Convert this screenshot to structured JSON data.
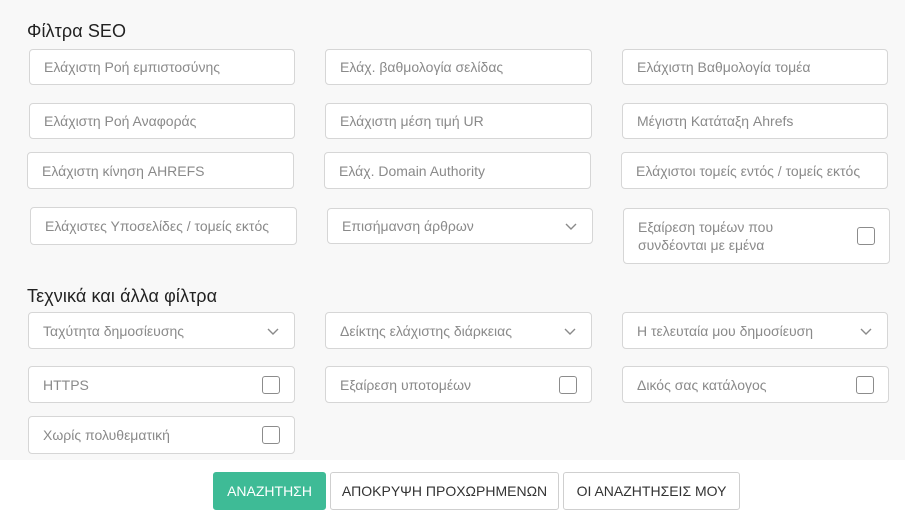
{
  "seo": {
    "heading": "Φίλτρα SEO",
    "fields": {
      "min_trust_flow": "Ελάχιστη Ροή εμπιστοσύνης",
      "min_page_rating": "Ελάχ. βαθμολογία σελίδας",
      "min_domain_rating": "Ελάχιστη Βαθμολογία τομέα",
      "min_citation_flow": "Ελάχιστη Ροή Αναφοράς",
      "min_avg_ur": "Ελάχιστη μέση τιμή UR",
      "max_ahrefs_rank": "Μέγιστη Κατάταξη Ahrefs",
      "min_ahrefs_traffic": "Ελάχιστη κίνηση AHREFS",
      "min_domain_authority": "Ελάχ. Domain Authority",
      "min_referring_domains": "Ελάχιστοι τομείς εντός / τομείς εκτός",
      "min_subpages": "Ελάχιστες Υποσελίδες / τομείς εκτός",
      "article_marking": "Επισήμανση άρθρων",
      "exclude_linked_domains": "Εξαίρεση τομέων που συνδέονται με εμένα"
    }
  },
  "technical": {
    "heading": "Τεχνικά και άλλα φίλτρα",
    "fields": {
      "publish_speed": "Ταχύτητα δημοσίευσης",
      "min_duration": "Δείκτης ελάχιστης διάρκειας",
      "my_last_publication": "Η τελευταία μου δημοσίευση",
      "https": "HTTPS",
      "exclude_subdomains": "Εξαίρεση υποτομέων",
      "own_catalog": "Δικός σας κατάλογος",
      "no_multitopic": "Χωρίς πολυθεματική"
    }
  },
  "footer": {
    "search": "ΑΝΑΖΗΤΗΣΗ",
    "hide_advanced": "ΑΠΟΚΡΥΨΗ ΠΡΟΧΩΡΗΜΕΝΩΝ",
    "my_searches": "ΟΙ ΑΝΑΖΗΤΗΣΕΙΣ ΜΟΥ"
  },
  "colors": {
    "primary_button": "#3ebb96",
    "background": "#f8f8f8"
  },
  "icons": {
    "dropdown": "chevron-down-icon",
    "checkbox": "checkbox-unchecked"
  }
}
